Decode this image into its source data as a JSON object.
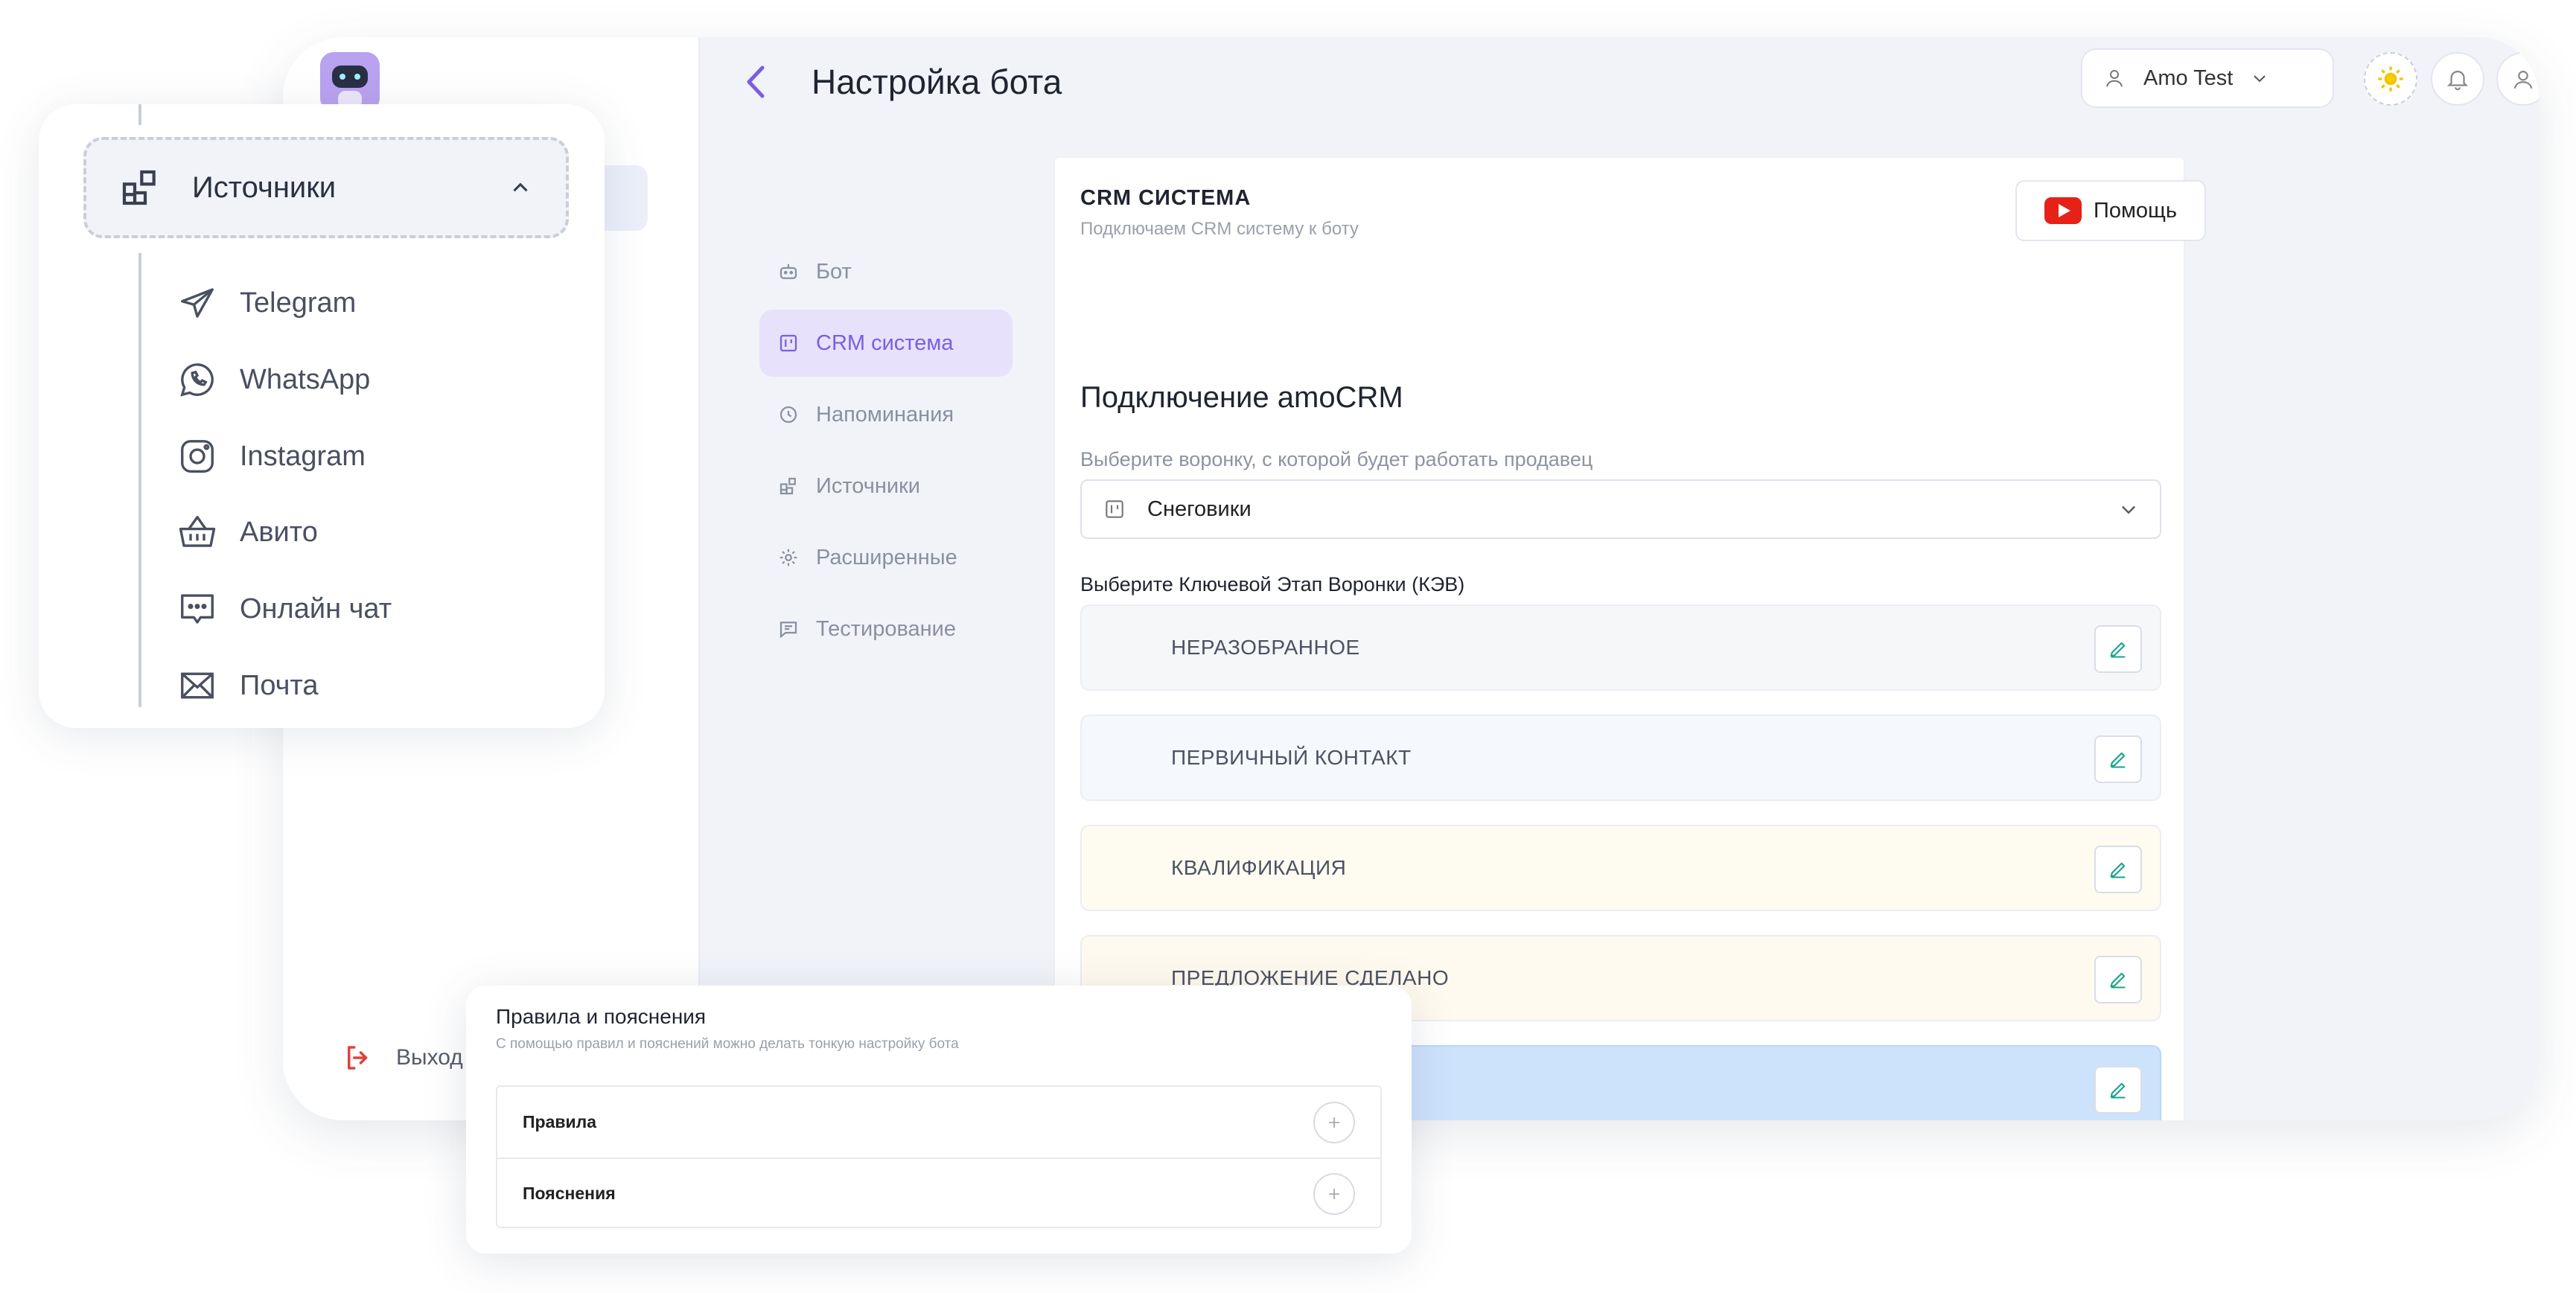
{
  "header": {
    "title": "Настройка бота",
    "account_name": "Amo Test"
  },
  "sidebar": {
    "logout_label": "Выход"
  },
  "settings_nav": [
    {
      "label": "Бот",
      "icon": "bot-icon"
    },
    {
      "label": "CRM система",
      "icon": "kanban-icon",
      "active": true
    },
    {
      "label": "Напоминания",
      "icon": "clock-icon"
    },
    {
      "label": "Источники",
      "icon": "blocks-icon"
    },
    {
      "label": "Расширенные",
      "icon": "gear-icon"
    },
    {
      "label": "Тестирование",
      "icon": "chat-icon"
    }
  ],
  "crm": {
    "title": "CRM СИСТЕМА",
    "subtitle": "Подключаем CRM систему к боту",
    "help_label": "Помощь",
    "section_title": "Подключение amoCRM",
    "funnel_label": "Выберите воронку, с которой будет работать продавец",
    "funnel_value": "Снеговики",
    "stage_label": "Выберите Ключевой Этап Воронки (КЭВ)",
    "stages": [
      {
        "label": "НЕРАЗОБРАННОЕ",
        "color": "#f6f7f9"
      },
      {
        "label": "ПЕРВИЧНЫЙ КОНТАКТ",
        "color": "#f5f9fe"
      },
      {
        "label": "КВАЛИФИКАЦИЯ",
        "color": "#fefcf1"
      },
      {
        "label": "ПРЕДЛОЖЕНИЕ СДЕЛАНО",
        "color": "#fffaef"
      },
      {
        "label": "",
        "color": "#cde3fc"
      },
      {
        "label": "",
        "color": "#f5f8fd"
      }
    ]
  },
  "sources_panel": {
    "title": "Источники",
    "items": [
      {
        "label": "Telegram",
        "icon": "telegram-icon"
      },
      {
        "label": "WhatsApp",
        "icon": "whatsapp-icon"
      },
      {
        "label": "Instagram",
        "icon": "instagram-icon"
      },
      {
        "label": "Авито",
        "icon": "basket-icon"
      },
      {
        "label": "Онлайн чат",
        "icon": "chat-bubble-icon"
      },
      {
        "label": "Почта",
        "icon": "mail-icon"
      }
    ]
  },
  "rules_panel": {
    "title": "Правила и пояснения",
    "subtitle": "С помощью правил и пояснений можно делать тонкую настройку бота",
    "rows": [
      {
        "label": "Правила"
      },
      {
        "label": "Пояснения"
      }
    ]
  },
  "colors": {
    "accent": "#7a5ee0",
    "edit_icon": "#1aa38a",
    "logout_icon": "#e0423c"
  }
}
